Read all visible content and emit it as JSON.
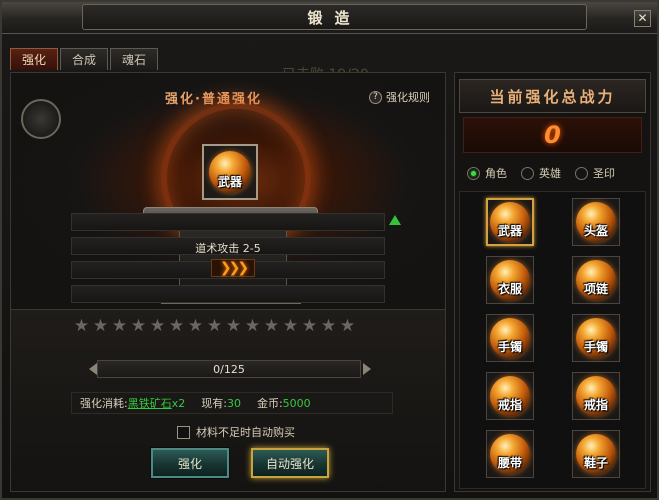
{
  "window": {
    "title": "锻造",
    "close_label": "✕"
  },
  "tabs": [
    {
      "label": "强化",
      "active": true
    },
    {
      "label": "合成",
      "active": false
    },
    {
      "label": "魂石",
      "active": false
    }
  ],
  "watermark": "已击败 19/20",
  "forge": {
    "subtitle": "强化·普通强化",
    "rules_icon": "?",
    "rules_label": "强化规则",
    "slot_item": "武器",
    "attributes": [
      "",
      "道术攻击 2-5",
      "",
      "",
      ""
    ],
    "arrow_glyph": "❯❯❯"
  },
  "enhance": {
    "stars_total": 15,
    "star_glyph": "★",
    "progress_text": "0/125",
    "progress_fraction": 0,
    "cost_label": "强化消耗:",
    "ore_name": "黑铁矿石",
    "ore_qty": "x2",
    "owned_label": "现有:",
    "owned_value": "30",
    "gold_label": "金币:",
    "gold_value": "5000",
    "auto_buy_label": "材料不足时自动购买",
    "strengthen_button": "强化",
    "auto_button": "自动强化"
  },
  "power": {
    "title": "当前强化总战力",
    "value": "0"
  },
  "radios": [
    {
      "label": "角色",
      "checked": true
    },
    {
      "label": "英雄",
      "checked": false
    },
    {
      "label": "圣印",
      "checked": false
    }
  ],
  "equipment": [
    {
      "label": "武器",
      "selected": true
    },
    {
      "label": "头盔",
      "selected": false
    },
    {
      "label": "衣服",
      "selected": false
    },
    {
      "label": "项链",
      "selected": false
    },
    {
      "label": "手镯",
      "selected": false
    },
    {
      "label": "手镯",
      "selected": false
    },
    {
      "label": "戒指",
      "selected": false
    },
    {
      "label": "戒指",
      "selected": false
    },
    {
      "label": "腰带",
      "selected": false
    },
    {
      "label": "鞋子",
      "selected": false
    }
  ]
}
